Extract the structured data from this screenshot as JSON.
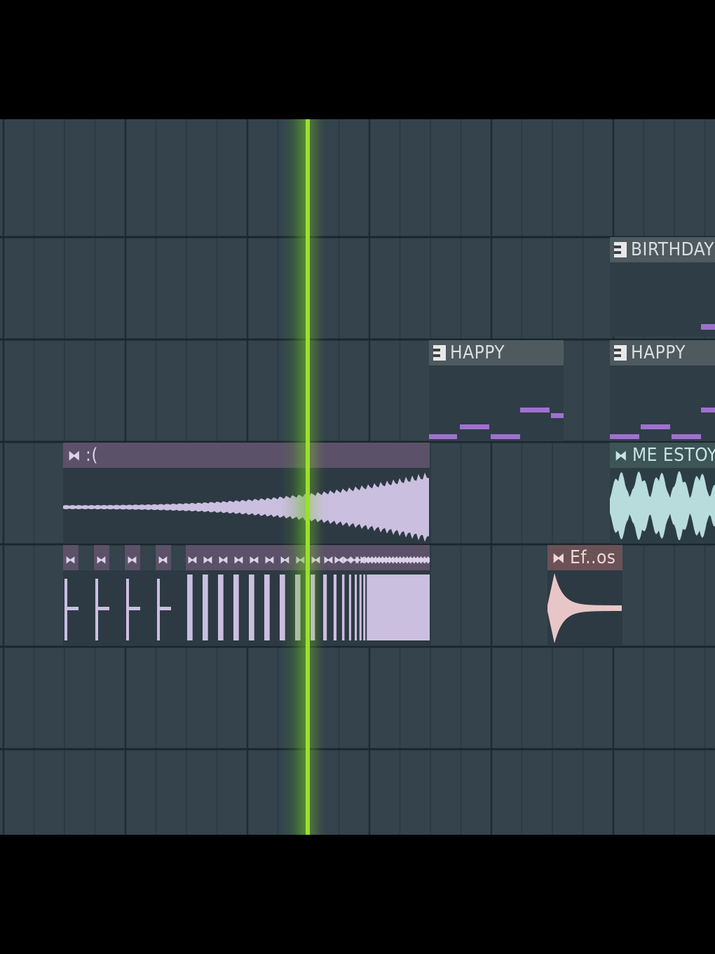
{
  "colors": {
    "background": "#34434c",
    "grid_line": "#24313a",
    "row_line": "#1c262d",
    "playhead": "#9ae12c",
    "note": "#a070d0",
    "wave_purple": "#cbbfe0",
    "wave_teal": "#b8dcdc",
    "wave_pink": "#e8c6c8"
  },
  "clips": {
    "birthday": {
      "label": "BIRTHDAY",
      "icon": "pattern-icon"
    },
    "happy_1": {
      "label": "HAPPY",
      "icon": "pattern-icon"
    },
    "happy_2": {
      "label": "HAPPY",
      "icon": "pattern-icon"
    },
    "sad": {
      "label": ":(",
      "icon": "audio-clip-icon"
    },
    "me_estoy": {
      "label": "ME ESTOY",
      "icon": "audio-clip-icon"
    },
    "efos": {
      "label": "Ef..os",
      "icon": "audio-clip-icon"
    },
    "clip_icon_glyph": "⧓"
  }
}
